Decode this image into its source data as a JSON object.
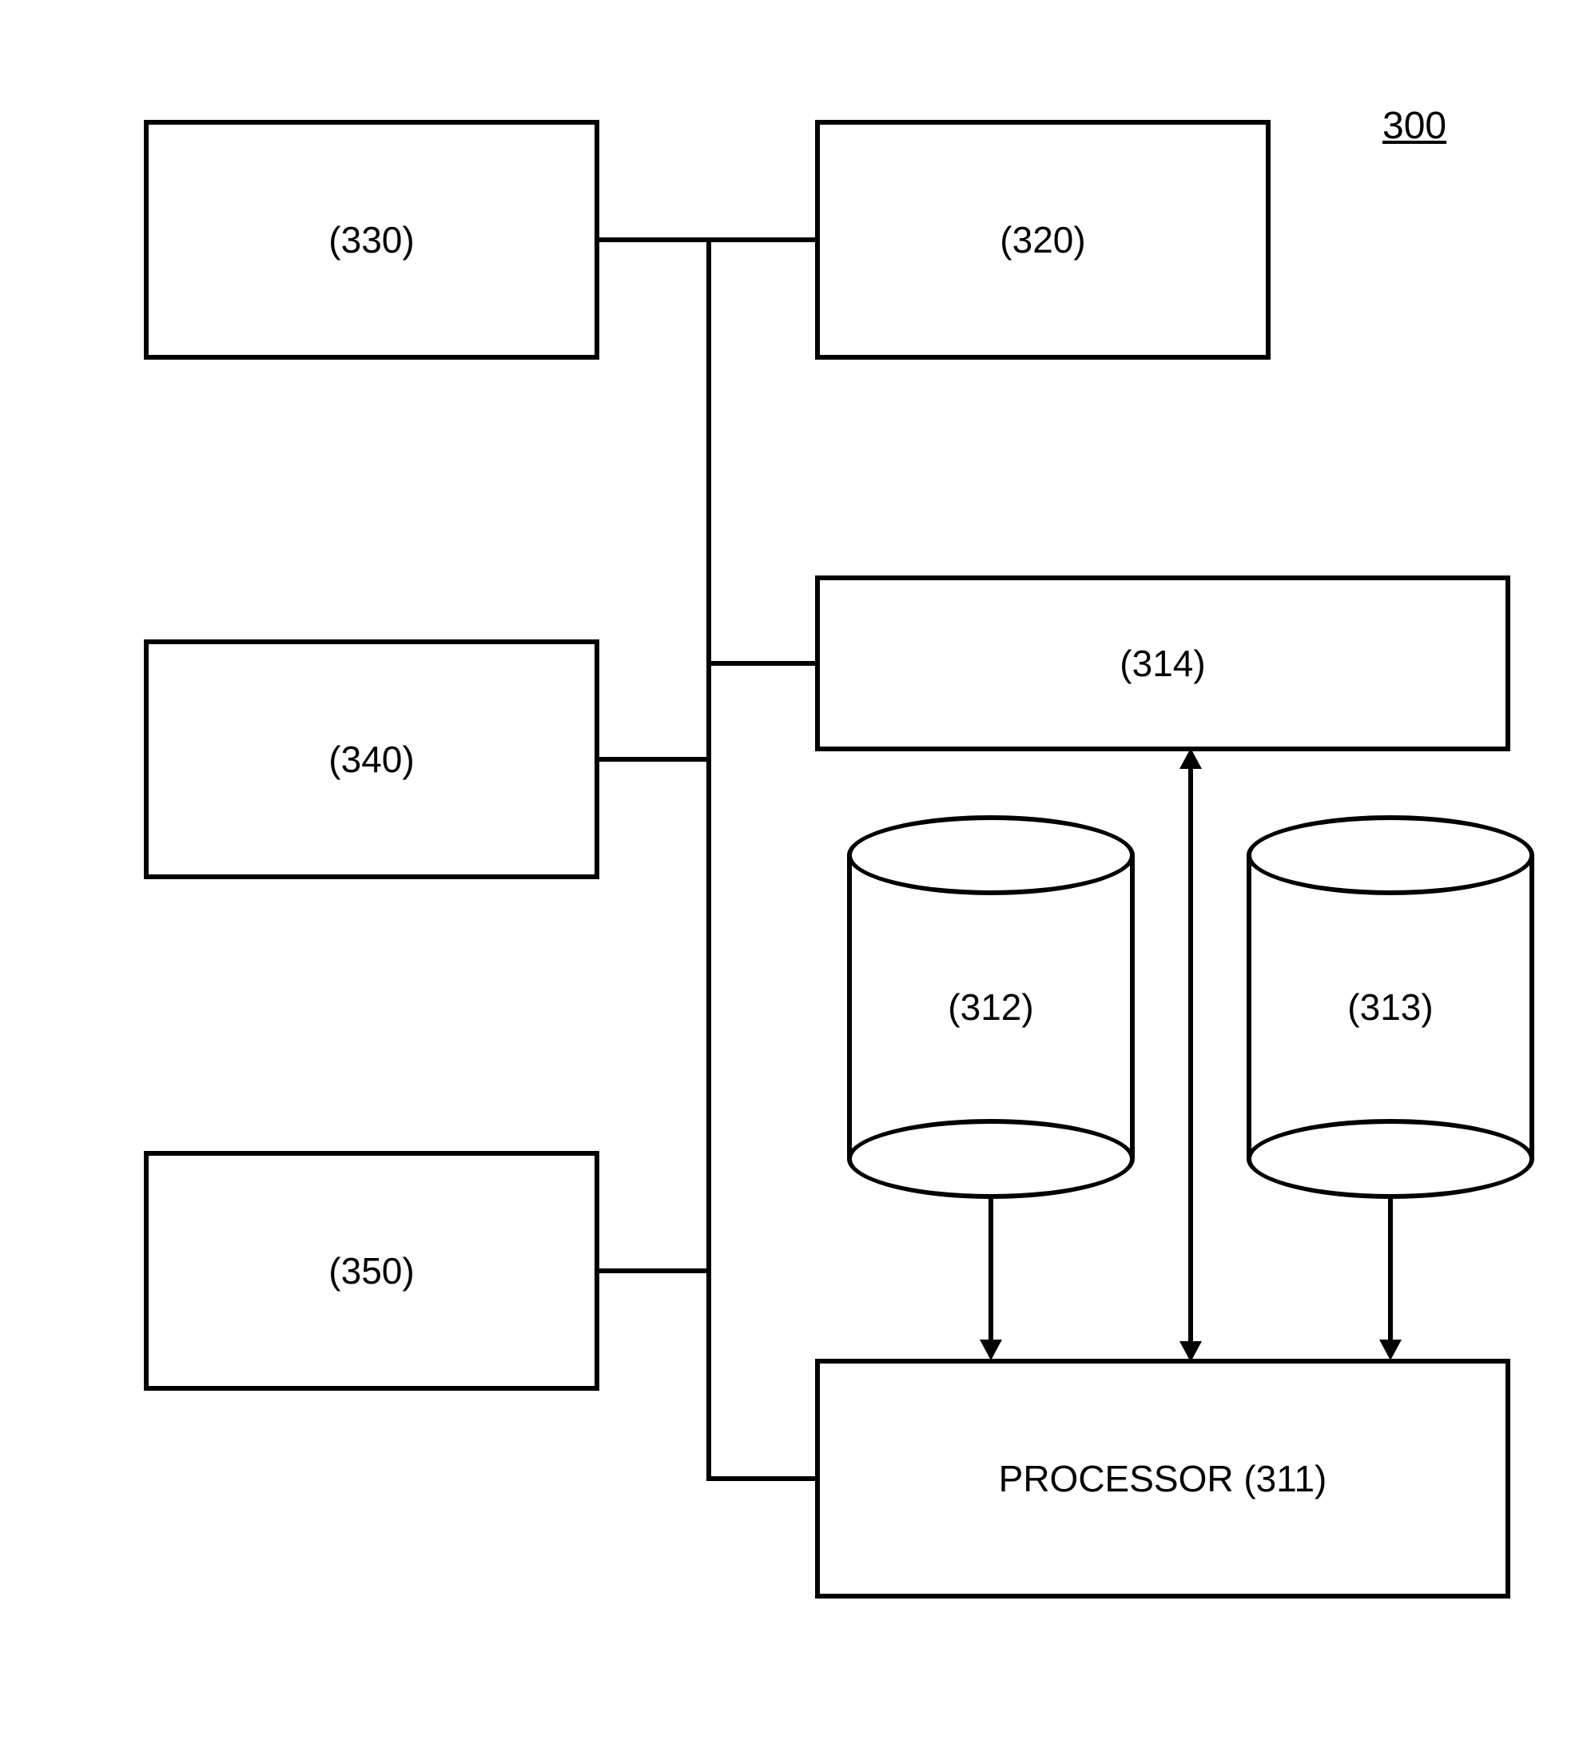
{
  "figure_label": "300",
  "blocks": {
    "b330": "(330)",
    "b320": "(320)",
    "b340": "(340)",
    "b350": "(350)",
    "b314": "(314)",
    "processor": "PROCESSOR (311)"
  },
  "cylinders": {
    "c312": "(312)",
    "c313": "(313)"
  }
}
